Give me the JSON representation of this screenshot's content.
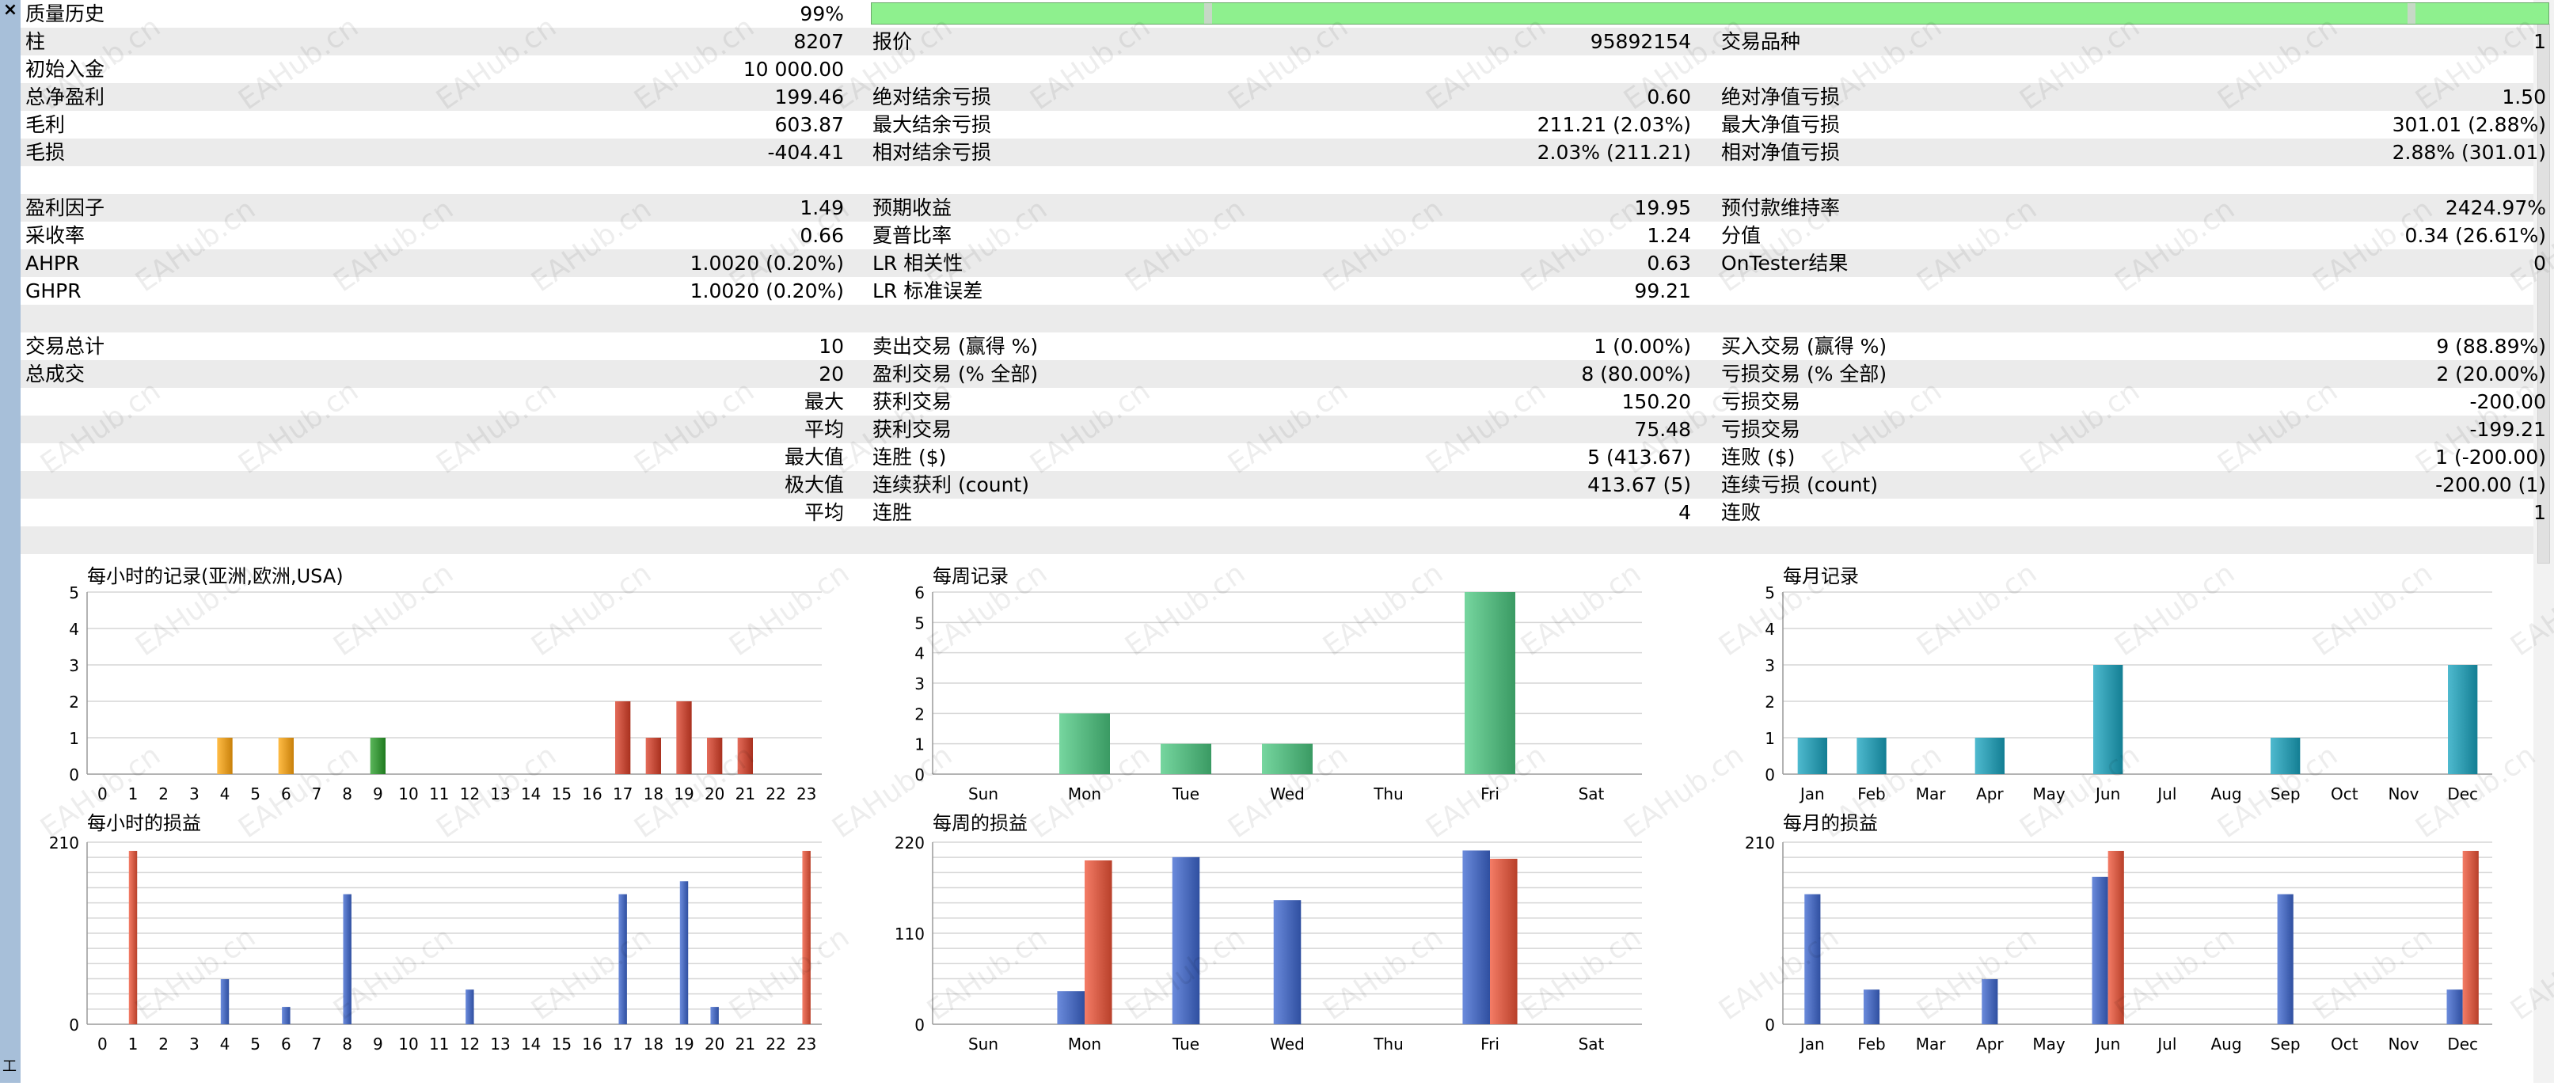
{
  "close_label": "×",
  "side_tab_label": "工",
  "watermark": "EAHub.cn",
  "stats_rows": [
    {
      "l1": "质量历史",
      "v1": "99%",
      "l2": "",
      "v2": "",
      "l3": "",
      "v3": "",
      "quality_bar": true
    },
    {
      "l1": "柱",
      "v1": "8207",
      "l2": "报价",
      "v2": "95892154",
      "l3": "交易品种",
      "v3": "1"
    },
    {
      "l1": "初始入金",
      "v1": "10 000.00",
      "l2": "",
      "v2": "",
      "l3": "",
      "v3": ""
    },
    {
      "l1": "总净盈利",
      "v1": "199.46",
      "l2": "绝对结余亏损",
      "v2": "0.60",
      "l3": "绝对净值亏损",
      "v3": "1.50"
    },
    {
      "l1": "毛利",
      "v1": "603.87",
      "l2": "最大结余亏损",
      "v2": "211.21 (2.03%)",
      "l3": "最大净值亏损",
      "v3": "301.01 (2.88%)"
    },
    {
      "l1": "毛损",
      "v1": "-404.41",
      "l2": "相对结余亏损",
      "v2": "2.03% (211.21)",
      "l3": "相对净值亏损",
      "v3": "2.88% (301.01)"
    },
    {
      "l1": "",
      "v1": "",
      "l2": "",
      "v2": "",
      "l3": "",
      "v3": ""
    },
    {
      "l1": "盈利因子",
      "v1": "1.49",
      "l2": "预期收益",
      "v2": "19.95",
      "l3": "预付款维持率",
      "v3": "2424.97%"
    },
    {
      "l1": "采收率",
      "v1": "0.66",
      "l2": "夏普比率",
      "v2": "1.24",
      "l3": "分值",
      "v3": "0.34 (26.61%)"
    },
    {
      "l1": "AHPR",
      "v1": "1.0020 (0.20%)",
      "l2": "LR 相关性",
      "v2": "0.63",
      "l3": "OnTester结果",
      "v3": "0"
    },
    {
      "l1": "GHPR",
      "v1": "1.0020 (0.20%)",
      "l2": "LR 标准误差",
      "v2": "99.21",
      "l3": "",
      "v3": ""
    },
    {
      "l1": "",
      "v1": "",
      "l2": "",
      "v2": "",
      "l3": "",
      "v3": ""
    },
    {
      "l1": "交易总计",
      "v1": "10",
      "l2": "卖出交易 (赢得 %)",
      "v2": "1 (0.00%)",
      "l3": "买入交易 (赢得 %)",
      "v3": "9 (88.89%)"
    },
    {
      "l1": "总成交",
      "v1": "20",
      "l2": "盈利交易 (% 全部)",
      "v2": "8 (80.00%)",
      "l3": "亏损交易 (% 全部)",
      "v3": "2 (20.00%)"
    },
    {
      "l1": "",
      "v1": "最大",
      "l2": "获利交易",
      "v2": "150.20",
      "l3": "亏损交易",
      "v3": "-200.00"
    },
    {
      "l1": "",
      "v1": "平均",
      "l2": "获利交易",
      "v2": "75.48",
      "l3": "亏损交易",
      "v3": "-199.21"
    },
    {
      "l1": "",
      "v1": "最大值",
      "l2": "连胜 ($)",
      "v2": "5 (413.67)",
      "l3": "连败 ($)",
      "v3": "1 (-200.00)"
    },
    {
      "l1": "",
      "v1": "极大值",
      "l2": "连续获利 (count)",
      "v2": "413.67 (5)",
      "l3": "连续亏损 (count)",
      "v3": "-200.00 (1)"
    },
    {
      "l1": "",
      "v1": "平均",
      "l2": "连胜",
      "v2": "4",
      "l3": "连败",
      "v3": "1"
    },
    {
      "l1": "",
      "v1": "",
      "l2": "",
      "v2": "",
      "l3": "",
      "v3": ""
    }
  ],
  "colors": {
    "hour_entry_orange": "#c8800a",
    "hour_entry_green": "#1f7a1f",
    "hour_entry_red": "#a8301e",
    "week_entry": "#3a9a63",
    "month_entry": "#137e93",
    "profit_blue": "#2f4fa0",
    "loss_red": "#b8402a",
    "grid": "#d6d6d6"
  },
  "chart_data": [
    {
      "id": "hours-entries",
      "type": "bar",
      "title": "每小时的记录(亚洲,欧洲,USA)",
      "categories": [
        "0",
        "1",
        "2",
        "3",
        "4",
        "5",
        "6",
        "7",
        "8",
        "9",
        "10",
        "11",
        "12",
        "13",
        "14",
        "15",
        "16",
        "17",
        "18",
        "19",
        "20",
        "21",
        "22",
        "23"
      ],
      "values": [
        0,
        0,
        0,
        0,
        1,
        0,
        1,
        0,
        0,
        1,
        0,
        0,
        0,
        0,
        0,
        0,
        0,
        2,
        1,
        2,
        1,
        1,
        0,
        0
      ],
      "bar_colors": [
        "",
        "",
        "",
        "",
        "orange",
        "",
        "orange",
        "",
        "",
        "green",
        "",
        "",
        "",
        "",
        "",
        "",
        "",
        "red",
        "red",
        "red",
        "red",
        "red",
        "",
        ""
      ],
      "yticks": [
        "0",
        "1",
        "2",
        "3",
        "4",
        "5"
      ],
      "ylim": [
        0,
        5
      ]
    },
    {
      "id": "week-entries",
      "type": "bar",
      "title": "每周记录",
      "categories": [
        "Sun",
        "Mon",
        "Tue",
        "Wed",
        "Thu",
        "Fri",
        "Sat"
      ],
      "values": [
        0,
        2,
        1,
        1,
        0,
        6,
        0
      ],
      "yticks": [
        "0",
        "1",
        "2",
        "3",
        "4",
        "5",
        "6"
      ],
      "ylim": [
        0,
        6
      ]
    },
    {
      "id": "month-entries",
      "type": "bar",
      "title": "每月记录",
      "categories": [
        "Jan",
        "Feb",
        "Mar",
        "Apr",
        "May",
        "Jun",
        "Jul",
        "Aug",
        "Sep",
        "Oct",
        "Nov",
        "Dec"
      ],
      "values": [
        1,
        1,
        0,
        1,
        0,
        3,
        0,
        0,
        1,
        0,
        0,
        3
      ],
      "yticks": [
        "0",
        "1",
        "2",
        "3",
        "4",
        "5"
      ],
      "ylim": [
        0,
        5
      ]
    },
    {
      "id": "hours-pnl",
      "type": "bar",
      "title": "每小时的损益",
      "categories": [
        "0",
        "1",
        "2",
        "3",
        "4",
        "5",
        "6",
        "7",
        "8",
        "9",
        "10",
        "11",
        "12",
        "13",
        "14",
        "15",
        "16",
        "17",
        "18",
        "19",
        "20",
        "21",
        "22",
        "23"
      ],
      "series": [
        {
          "values": [
            0,
            0,
            0,
            0,
            52,
            0,
            20,
            0,
            150,
            0,
            0,
            0,
            40,
            0,
            0,
            0,
            0,
            150,
            0,
            165,
            20,
            0,
            0,
            0
          ],
          "color": "profit"
        },
        {
          "values": [
            0,
            200,
            0,
            0,
            0,
            0,
            0,
            0,
            0,
            0,
            0,
            0,
            0,
            0,
            0,
            0,
            0,
            0,
            0,
            0,
            0,
            0,
            0,
            200
          ],
          "color": "loss"
        }
      ],
      "yticks": [
        "0",
        "210"
      ],
      "ylim": [
        0,
        210
      ]
    },
    {
      "id": "week-pnl",
      "type": "bar",
      "title": "每周的损益",
      "categories": [
        "Sun",
        "Mon",
        "Tue",
        "Wed",
        "Thu",
        "Fri",
        "Sat"
      ],
      "series": [
        {
          "values": [
            0,
            40,
            202,
            150,
            0,
            210,
            0
          ],
          "color": "profit"
        },
        {
          "values": [
            0,
            198,
            0,
            0,
            0,
            200,
            0
          ],
          "color": "loss"
        }
      ],
      "yticks": [
        "0",
        "110",
        "220"
      ],
      "ylim": [
        0,
        220
      ]
    },
    {
      "id": "month-pnl",
      "type": "bar",
      "title": "每月的损益",
      "categories": [
        "Jan",
        "Feb",
        "Mar",
        "Apr",
        "May",
        "Jun",
        "Jul",
        "Aug",
        "Sep",
        "Oct",
        "Nov",
        "Dec"
      ],
      "series": [
        {
          "values": [
            150,
            40,
            0,
            52,
            0,
            170,
            0,
            0,
            150,
            0,
            0,
            40
          ],
          "color": "profit"
        },
        {
          "values": [
            0,
            0,
            0,
            0,
            0,
            200,
            0,
            0,
            0,
            0,
            0,
            200
          ],
          "color": "loss"
        }
      ],
      "yticks": [
        "0",
        "210"
      ],
      "ylim": [
        0,
        210
      ]
    }
  ]
}
